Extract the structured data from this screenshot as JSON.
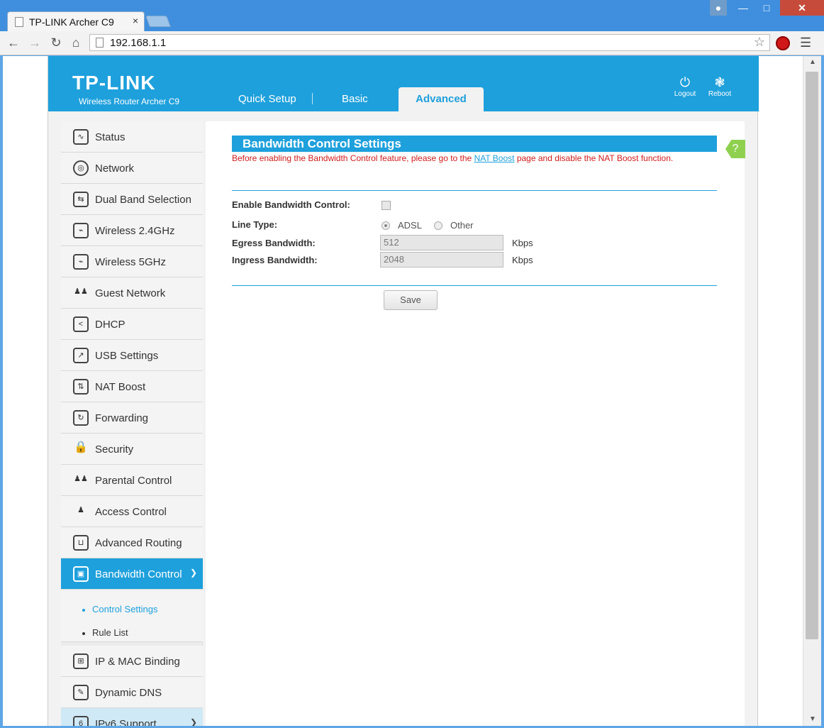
{
  "browser": {
    "tab_title": "TP-LINK Archer C9",
    "tab_close": "×",
    "url": "192.168.1.1"
  },
  "header": {
    "logo": "TP-LINK",
    "model": "Wireless Router Archer C9",
    "nav": {
      "quick_setup": "Quick Setup",
      "basic": "Basic",
      "advanced": "Advanced"
    },
    "logout": "Logout",
    "reboot": "Reboot"
  },
  "sidebar": {
    "items": [
      {
        "label": "Status",
        "icon": "status-icon"
      },
      {
        "label": "Network",
        "icon": "globe-icon"
      },
      {
        "label": "Dual Band Selection",
        "icon": "dual-band-icon"
      },
      {
        "label": "Wireless 2.4GHz",
        "icon": "wireless-icon"
      },
      {
        "label": "Wireless 5GHz",
        "icon": "wireless-icon"
      },
      {
        "label": "Guest Network",
        "icon": "guest-icon"
      },
      {
        "label": "DHCP",
        "icon": "monitor-icon"
      },
      {
        "label": "USB Settings",
        "icon": "usb-icon"
      },
      {
        "label": "NAT Boost",
        "icon": "nat-icon"
      },
      {
        "label": "Forwarding",
        "icon": "forwarding-icon"
      },
      {
        "label": "Security",
        "icon": "lock-icon"
      },
      {
        "label": "Parental Control",
        "icon": "parental-icon"
      },
      {
        "label": "Access Control",
        "icon": "access-icon"
      },
      {
        "label": "Advanced Routing",
        "icon": "routing-icon"
      },
      {
        "label": "Bandwidth Control",
        "icon": "bandwidth-icon"
      }
    ],
    "sub_items": {
      "control_settings": "Control Settings",
      "rule_list": "Rule List"
    },
    "after_items": [
      {
        "label": "IP & MAC Binding",
        "icon": "binding-icon"
      },
      {
        "label": "Dynamic DNS",
        "icon": "ddns-icon"
      },
      {
        "label": "IPv6 Support",
        "icon": "ipv6-icon"
      }
    ]
  },
  "content": {
    "title": "Bandwidth Control Settings",
    "notice_before": "Before enabling the Bandwidth Control feature, please go to the ",
    "notice_link": "NAT Boost",
    "notice_after": " page and disable the NAT Boost function.",
    "help": "?",
    "fields": {
      "enable_label": "Enable Bandwidth Control:",
      "line_type_label": "Line Type:",
      "adsl": "ADSL",
      "other": "Other",
      "egress_label": "Egress Bandwidth:",
      "egress_value": "512",
      "ingress_label": "Ingress Bandwidth:",
      "ingress_value": "2048",
      "unit": "Kbps"
    },
    "save": "Save"
  }
}
